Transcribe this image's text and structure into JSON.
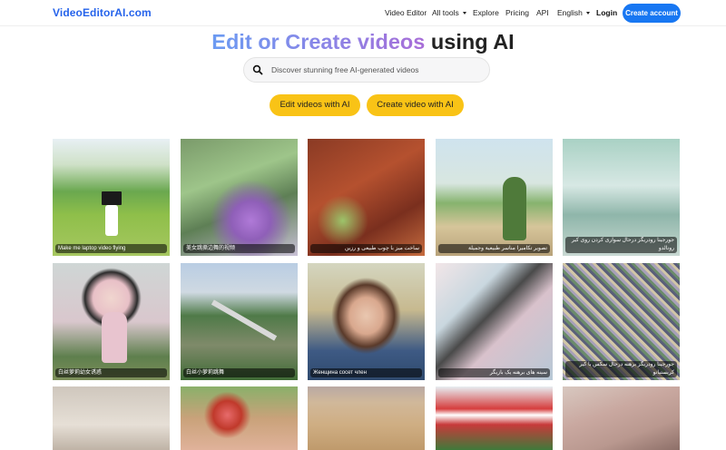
{
  "nav": {
    "logo": "VideoEditorAI.com",
    "links": {
      "video_editor": "Video Editor",
      "all_tools": "All tools",
      "explore": "Explore",
      "pricing": "Pricing",
      "api": "API",
      "language": "English"
    },
    "login": "Login",
    "create_account": "Create account"
  },
  "hero": {
    "title_part1": "Edit or Create videos",
    "title_part2": "using AI",
    "search_placeholder": "Discover stunning free AI-generated videos",
    "edit_button": "Edit videos with AI",
    "create_button": "Create video with AI"
  },
  "gallery": {
    "captions": [
      "Make me laptop video flying",
      "美女跳撕边舞的视频",
      "ساخت میز با چوب طبیعی و رزین",
      "تصویر تکامیرا مناسر طبیعیة وجمیلة",
      "جورجینا رودریگز درحال سواری کردن روی کیر رونالدو",
      "白丝萝莉幼女诱惑",
      "白丝小萝莉跳舞",
      "Женщина сосет член",
      "سینه های برهنه یک بازیگر",
      "جورجینا رودریگز برهنه درحال سکس با کیر کریستیانو"
    ]
  }
}
